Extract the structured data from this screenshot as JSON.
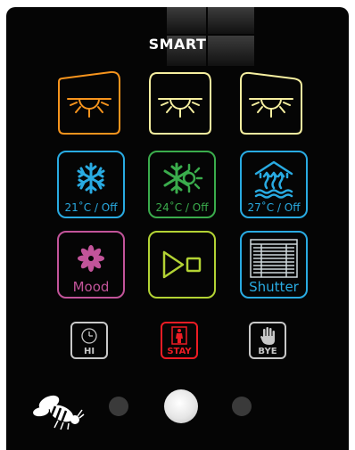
{
  "panel": {
    "title": "SMART"
  },
  "lights": [
    {
      "color": "#f7941d"
    },
    {
      "color": "#f6efa0"
    },
    {
      "color": "#f6efa0"
    }
  ],
  "climate": [
    {
      "label": "21˚C / Off",
      "color": "#29abe2",
      "icon": "snowflake-icon"
    },
    {
      "label": "24˚C / Off",
      "color": "#3aac4c",
      "icon": "snowflake-sun-icon"
    },
    {
      "label": "27˚C / Off",
      "color": "#29abe2",
      "icon": "floor-heating-icon"
    }
  ],
  "modes": [
    {
      "label": "Mood",
      "color": "#c2549a",
      "icon": "flower-icon"
    },
    {
      "label": "",
      "color": "#b3d334",
      "icon": "play-stop-icon"
    },
    {
      "label": "Shutter",
      "color": "#29abe2",
      "icon": "shutter-icon"
    }
  ],
  "scenes": [
    {
      "label": "HI",
      "color": "#c8c8c8",
      "icon": "clock-icon"
    },
    {
      "label": "STAY",
      "color": "#ed1c24",
      "icon": "person-door-icon"
    },
    {
      "label": "BYE",
      "color": "#c8c8c8",
      "icon": "hand-icon"
    }
  ],
  "brand": {
    "icon": "bee-logo-icon"
  },
  "pager": {
    "pages": 3,
    "active": 1
  }
}
